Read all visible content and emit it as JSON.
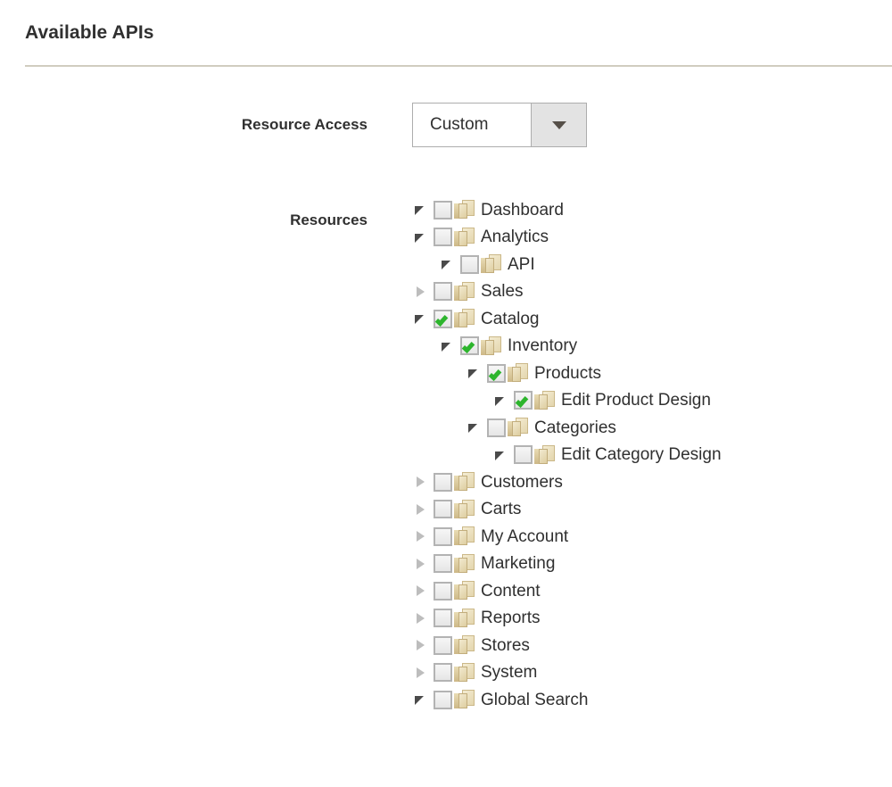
{
  "section": {
    "title": "Available APIs"
  },
  "resource_access": {
    "label": "Resource Access",
    "selected": "Custom",
    "options": [
      "Custom"
    ],
    "caret_icon": "chevron-down-icon"
  },
  "resources": {
    "label": "Resources",
    "colors": {
      "check": "#2db52d",
      "rule": "#d6d3c8",
      "text": "#303030",
      "folder": "#e3d5ad",
      "select_border": "#adadad",
      "select_button": "#e3e3e3"
    },
    "tree": [
      {
        "label": "Dashboard",
        "level": 0,
        "state": "expanded",
        "checked": false
      },
      {
        "label": "Analytics",
        "level": 0,
        "state": "expanded",
        "checked": false
      },
      {
        "label": "API",
        "level": 1,
        "state": "expanded",
        "checked": false
      },
      {
        "label": "Sales",
        "level": 0,
        "state": "collapsed",
        "checked": false
      },
      {
        "label": "Catalog",
        "level": 0,
        "state": "expanded",
        "checked": true
      },
      {
        "label": "Inventory",
        "level": 1,
        "state": "expanded",
        "checked": true
      },
      {
        "label": "Products",
        "level": 2,
        "state": "expanded",
        "checked": true
      },
      {
        "label": "Edit Product Design",
        "level": 3,
        "state": "expanded",
        "checked": true
      },
      {
        "label": "Categories",
        "level": 2,
        "state": "expanded",
        "checked": false
      },
      {
        "label": "Edit Category Design",
        "level": 3,
        "state": "expanded",
        "checked": false
      },
      {
        "label": "Customers",
        "level": 0,
        "state": "collapsed",
        "checked": false
      },
      {
        "label": "Carts",
        "level": 0,
        "state": "collapsed",
        "checked": false
      },
      {
        "label": "My Account",
        "level": 0,
        "state": "collapsed",
        "checked": false
      },
      {
        "label": "Marketing",
        "level": 0,
        "state": "collapsed",
        "checked": false
      },
      {
        "label": "Content",
        "level": 0,
        "state": "collapsed",
        "checked": false
      },
      {
        "label": "Reports",
        "level": 0,
        "state": "collapsed",
        "checked": false
      },
      {
        "label": "Stores",
        "level": 0,
        "state": "collapsed",
        "checked": false
      },
      {
        "label": "System",
        "level": 0,
        "state": "collapsed",
        "checked": false
      },
      {
        "label": "Global Search",
        "level": 0,
        "state": "expanded",
        "checked": false
      }
    ]
  }
}
